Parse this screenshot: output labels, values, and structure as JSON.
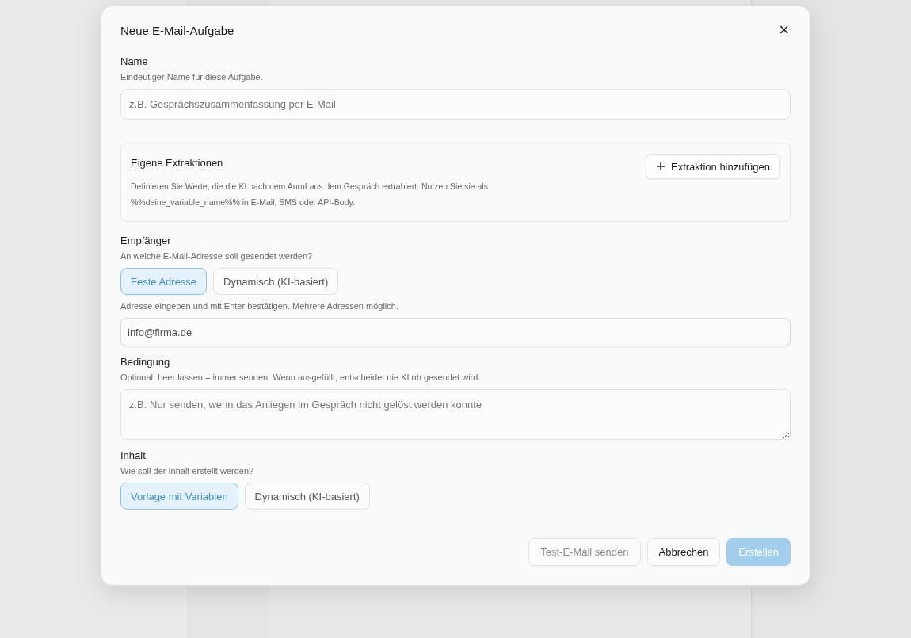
{
  "dialog": {
    "title": "Neue E-Mail-Aufgabe",
    "close": "×"
  },
  "name_section": {
    "label": "Name",
    "hint": "Eindeutiger Name für diese Aufgabe.",
    "field": {
      "placeholder": "z.B. Gesprächszusammenfassung per E-Mail"
    }
  },
  "extractions": {
    "title": "Eigene Extraktionen",
    "description": "Definieren Sie Werte, die die KI nach dem Anruf aus dem Gespräch extrahiert. Nutzen Sie sie als %%deine_variable_name%% in E-Mail, SMS oder API-Body.",
    "button": "Extraktion hinzufügen"
  },
  "recipient": {
    "label": "Empfänger",
    "hint": "An welche E-Mail-Adresse soll gesendet werden?",
    "options": [
      {
        "label": "Feste Adresse",
        "selected": true
      },
      {
        "label": "Dynamisch (KI-basiert)",
        "selected": false
      }
    ],
    "field_hint": "Adresse eingeben und mit Enter bestätigen. Mehrere Adressen möglich.",
    "field": {
      "value": "info@firma.de"
    }
  },
  "condition": {
    "label": "Bedingung",
    "hint": "Optional. Leer lassen = immer senden. Wenn ausgefüllt, entscheidet die KI ob gesendet wird.",
    "field": {
      "placeholder": "z.B. Nur senden, wenn das Anliegen im Gespräch nicht gelöst werden konnte"
    }
  },
  "content": {
    "label": "Inhalt",
    "hint": "Wie soll der Inhalt erstellt werden?",
    "options": [
      {
        "label": "Vorlage mit Variablen",
        "selected": true
      },
      {
        "label": "Dynamisch (KI-basiert)",
        "selected": false
      }
    ]
  },
  "footer_buttons": [
    {
      "label": "Test-E-Mail senden",
      "kind": "secondary",
      "disabled": true
    },
    {
      "label": "Abbrechen",
      "kind": "secondary",
      "disabled": false
    },
    {
      "label": "Erstellen",
      "kind": "primary",
      "disabled": true
    }
  ]
}
